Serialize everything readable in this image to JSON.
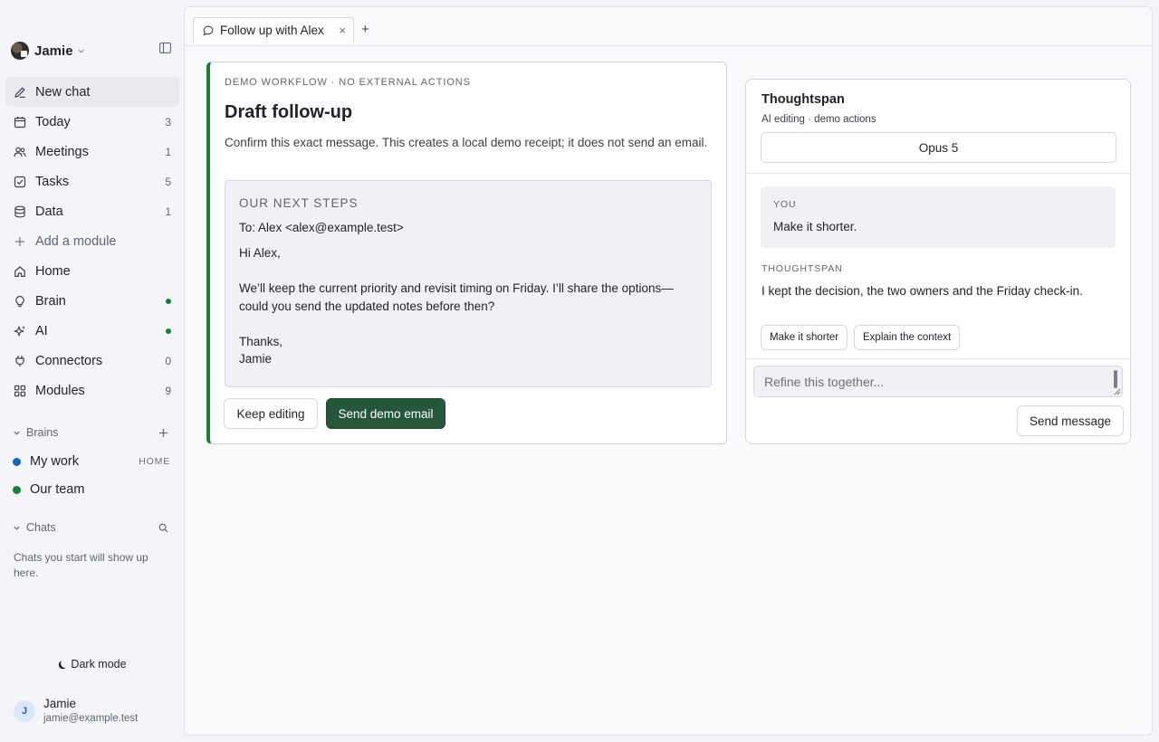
{
  "workspace": {
    "name": "Jamie"
  },
  "nav": [
    {
      "label": "New chat",
      "count": "",
      "icon": "edit-icon"
    },
    {
      "label": "Today",
      "count": "3",
      "icon": "calendar-icon"
    },
    {
      "label": "Meetings",
      "count": "1",
      "icon": "people-icon"
    },
    {
      "label": "Tasks",
      "count": "5",
      "icon": "checkbox-icon"
    },
    {
      "label": "Data",
      "count": "1",
      "icon": "database-icon"
    },
    {
      "label": "Add a module",
      "count": "",
      "icon": "plus-icon"
    },
    {
      "label": "Home",
      "count": "",
      "icon": "home-icon"
    },
    {
      "label": "Brain",
      "count": "",
      "icon": "lightbulb-icon",
      "status": "online"
    },
    {
      "label": "AI",
      "count": "",
      "icon": "sparkle-icon",
      "status": "online"
    },
    {
      "label": "Connectors",
      "count": "0",
      "icon": "plug-icon"
    },
    {
      "label": "Modules",
      "count": "9",
      "icon": "grid-icon"
    }
  ],
  "brains": {
    "heading": "Brains",
    "items": [
      {
        "label": "My work",
        "badge": "HOME",
        "color": "#1565c0"
      },
      {
        "label": "Our team",
        "badge": "",
        "color": "#1e7b3e"
      }
    ]
  },
  "chats": {
    "heading": "Chats",
    "empty_text": "Chats you start will show up here."
  },
  "dark_mode_label": "Dark mode",
  "user": {
    "initial": "J",
    "name": "Jamie",
    "email": "jamie@example.test"
  },
  "tabs": [
    {
      "label": "Follow up with Alex",
      "close": "×"
    }
  ],
  "tab_add": "+",
  "draft": {
    "eyebrow": "DEMO WORKFLOW · NO EXTERNAL ACTIONS",
    "title": "Draft follow-up",
    "description": "Confirm this exact message. This creates a local demo receipt; it does not send an email.",
    "email": {
      "subject": "OUR NEXT STEPS",
      "to": "To: Alex <alex@example.test>",
      "greeting": "Hi Alex,",
      "body": "We’ll keep the current priority and revisit timing on Friday. I’ll share the options—could you send the updated notes before then?",
      "closing": "Thanks,",
      "signature": "Jamie"
    },
    "keep_editing_label": "Keep editing",
    "send_label": "Send demo email"
  },
  "assistant": {
    "title": "Thoughtspan",
    "subtitle": "AI editing · demo actions",
    "model": "Opus 5",
    "messages": [
      {
        "role": "YOU",
        "text": "Make it shorter."
      },
      {
        "role": "THOUGHTSPAN",
        "text": "I kept the decision, the two owners and the Friday check-in."
      }
    ],
    "suggestions": [
      "Make it shorter",
      "Explain the context"
    ],
    "composer_placeholder": "Refine this together...",
    "send_label": "Send message"
  },
  "colors": {
    "accent_green": "#27573b",
    "draft_border": "#1e7a3c",
    "status_green": "#1e7b3e",
    "brain_blue": "#1565c0"
  }
}
